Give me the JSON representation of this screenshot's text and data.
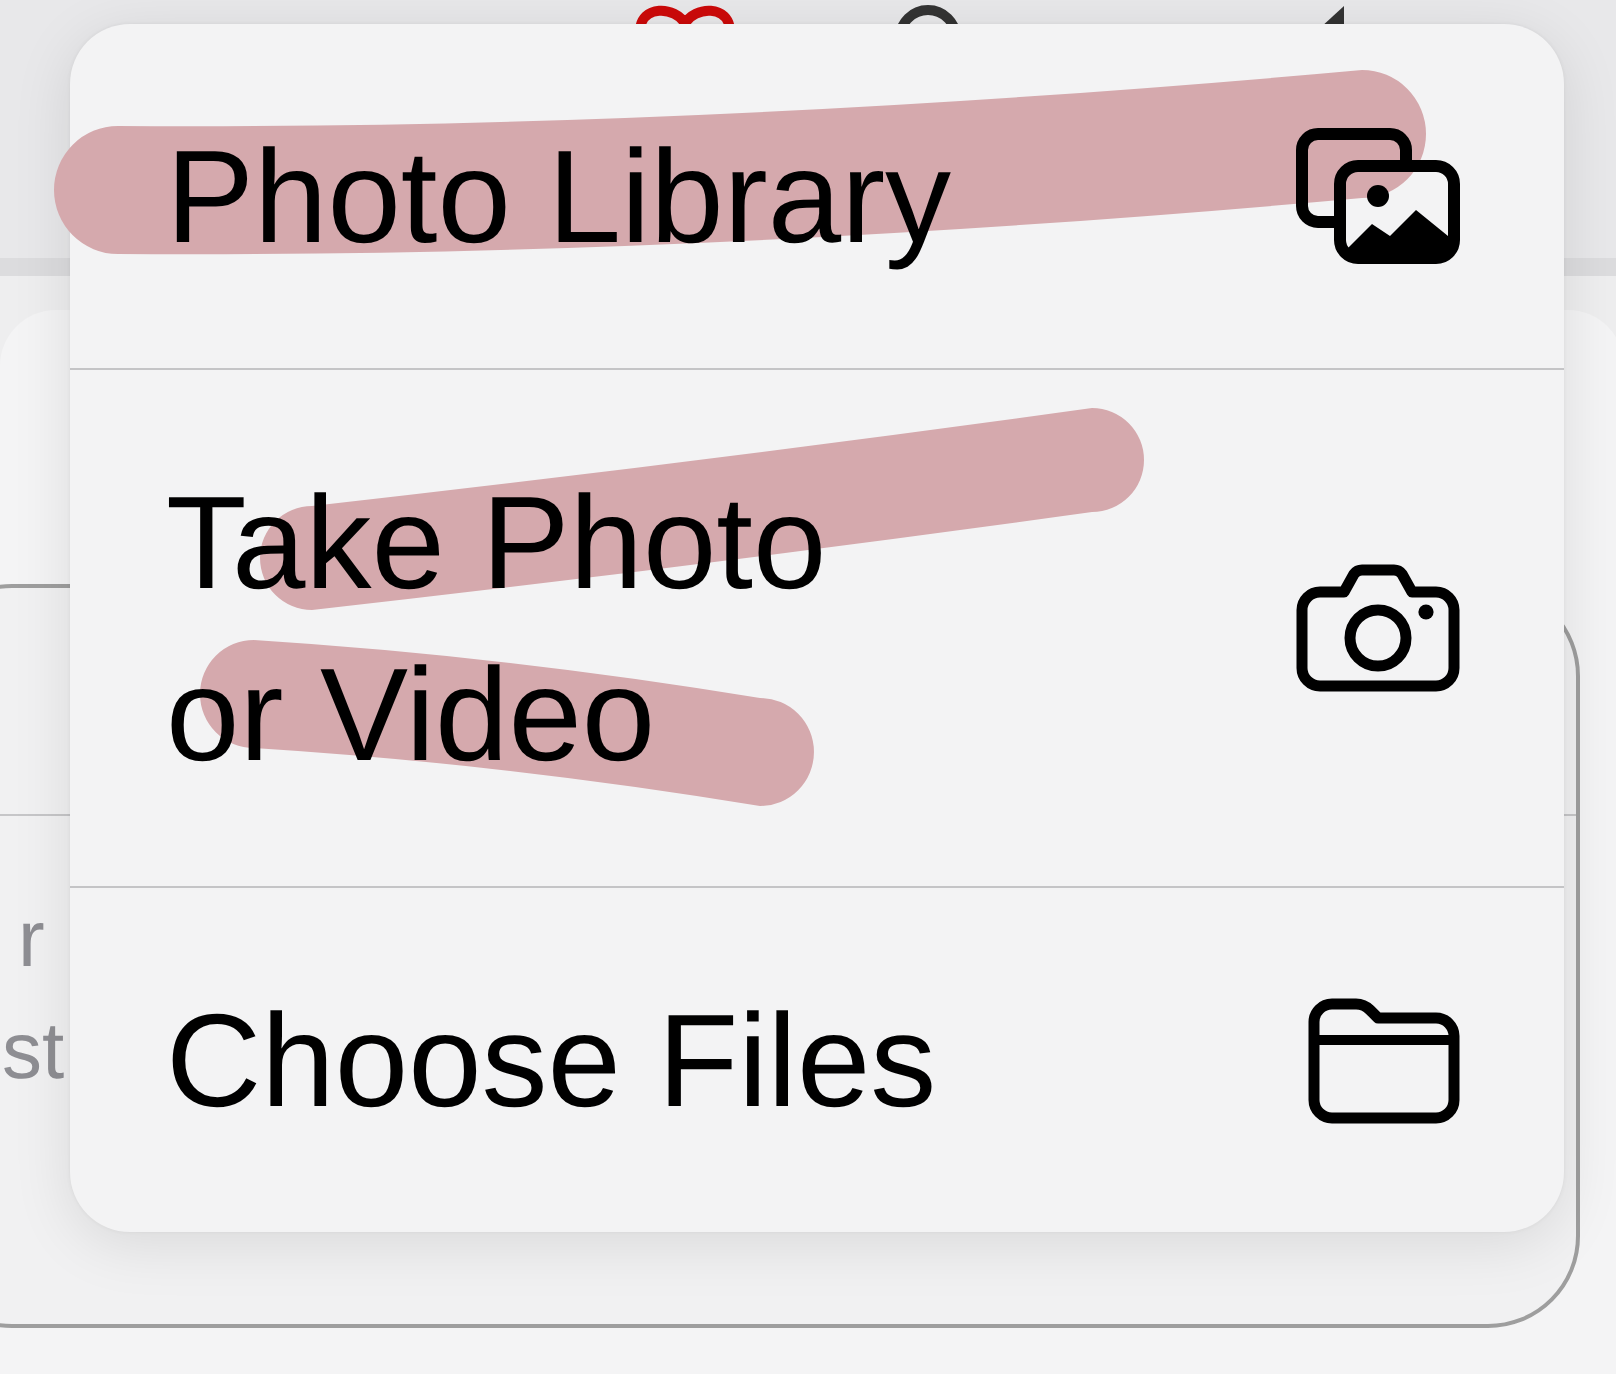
{
  "menu": {
    "items": [
      {
        "label": "Photo Library",
        "highlighted": true
      },
      {
        "label": "Take Photo or Video",
        "highlighted": true
      },
      {
        "label": "Choose Files",
        "highlighted": false
      }
    ]
  },
  "background_card": {
    "text_fragments": [
      "r",
      "st"
    ]
  }
}
